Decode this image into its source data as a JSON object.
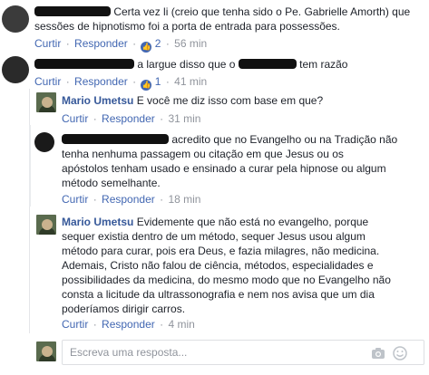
{
  "comments": [
    {
      "author": "",
      "text": "Certa vez li (creio que tenha sido o Pe. Gabrielle Amorth) que sessões de hipnotismo foi a porta de entrada para possessões.",
      "actions": {
        "like": "Curtir",
        "reply": "Responder",
        "likes": "2",
        "time": "56 min"
      }
    },
    {
      "author": "",
      "text": "a largue disso que o",
      "text_end": "tem razão",
      "actions": {
        "like": "Curtir",
        "reply": "Responder",
        "likes": "1",
        "time": "41 min"
      }
    }
  ],
  "replies": [
    {
      "author": "Mario Umetsu",
      "text": "E você me diz isso com base em que?",
      "actions": {
        "like": "Curtir",
        "reply": "Responder",
        "time": "31 min"
      }
    },
    {
      "author": "",
      "text_lines": [
        "acredito que no Evangelho ou na Tradição não",
        "tenha nenhuma passagem ou citação em que Jesus ou os",
        "apóstolos tenham usado e ensinado a curar pela hipnose ou algum",
        "método semelhante."
      ],
      "actions": {
        "like": "Curtir",
        "reply": "Responder",
        "time": "18 min"
      }
    },
    {
      "author": "Mario Umetsu",
      "text_lines": [
        "Evidemente que não está no evangelho, porque",
        "sequer existia dentro de um método, sequer Jesus usou algum",
        "método para curar, pois era Deus, e fazia milagres, não medicina.",
        "Ademais, Cristo não falou de ciência, métodos, especialidades e",
        "possibilidades da medicina, do mesmo modo que no Evangelho não",
        "consta a licitude da ultrassonografia e nem nos avisa que um dia",
        "poderíamos dirigir carros."
      ],
      "actions": {
        "like": "Curtir",
        "reply": "Responder",
        "time": "4 min"
      }
    }
  ],
  "composer": {
    "placeholder": "Escreva uma resposta..."
  },
  "colors": {
    "link": "#4267b2",
    "name": "#365899",
    "meta": "#90949c",
    "text": "#1d2129"
  },
  "icons": [
    "like-icon",
    "camera-icon",
    "emoji-icon"
  ]
}
